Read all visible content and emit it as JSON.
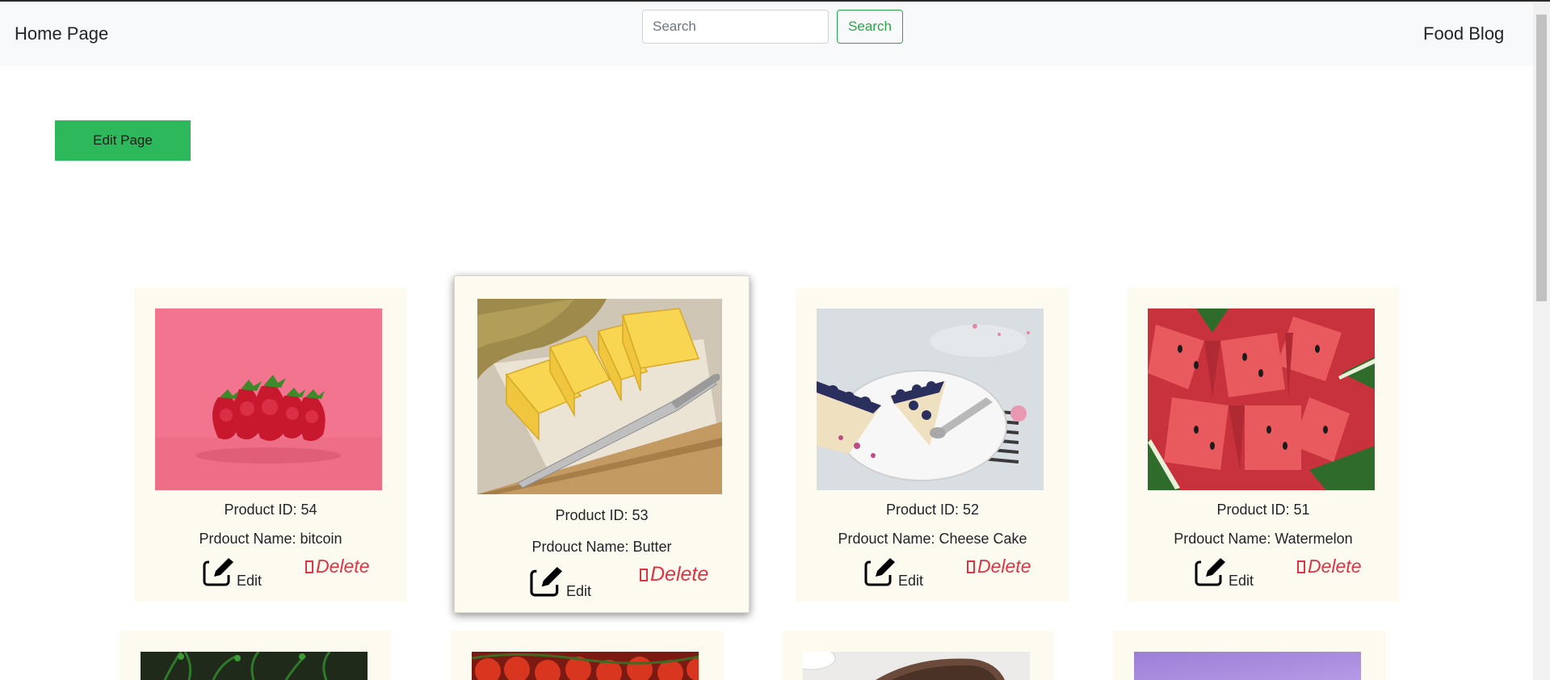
{
  "nav": {
    "home_label": "Home Page",
    "brand_label": "Food Blog",
    "search_placeholder": "Search",
    "search_button": "Search"
  },
  "main": {
    "edit_page_label": "Edit Page"
  },
  "products": [
    {
      "id_text": "Product ID: 54",
      "name_text": "Prdouct Name: bitcoin",
      "edit_label": "Edit",
      "delete_label": "Delete",
      "image": "strawberries"
    },
    {
      "id_text": "Product ID: 53",
      "name_text": "Prdouct Name: Butter",
      "edit_label": "Edit",
      "delete_label": "Delete",
      "image": "butter"
    },
    {
      "id_text": "Product ID: 52",
      "name_text": "Prdouct Name: Cheese Cake",
      "edit_label": "Edit",
      "delete_label": "Delete",
      "image": "blueberry-pie"
    },
    {
      "id_text": "Product ID: 51",
      "name_text": "Prdouct Name: Watermelon",
      "edit_label": "Edit",
      "delete_label": "Delete",
      "image": "watermelon"
    }
  ],
  "next_row_images": [
    "herbs",
    "tomatoes",
    "chocolate-cake",
    "purple-background"
  ],
  "colors": {
    "accent_green": "#28a745",
    "edit_page_button": "#2eb85c",
    "delete_red": "#dc3545",
    "card_background": "#fdfaf0",
    "navbar_background": "#f8f9fa"
  }
}
